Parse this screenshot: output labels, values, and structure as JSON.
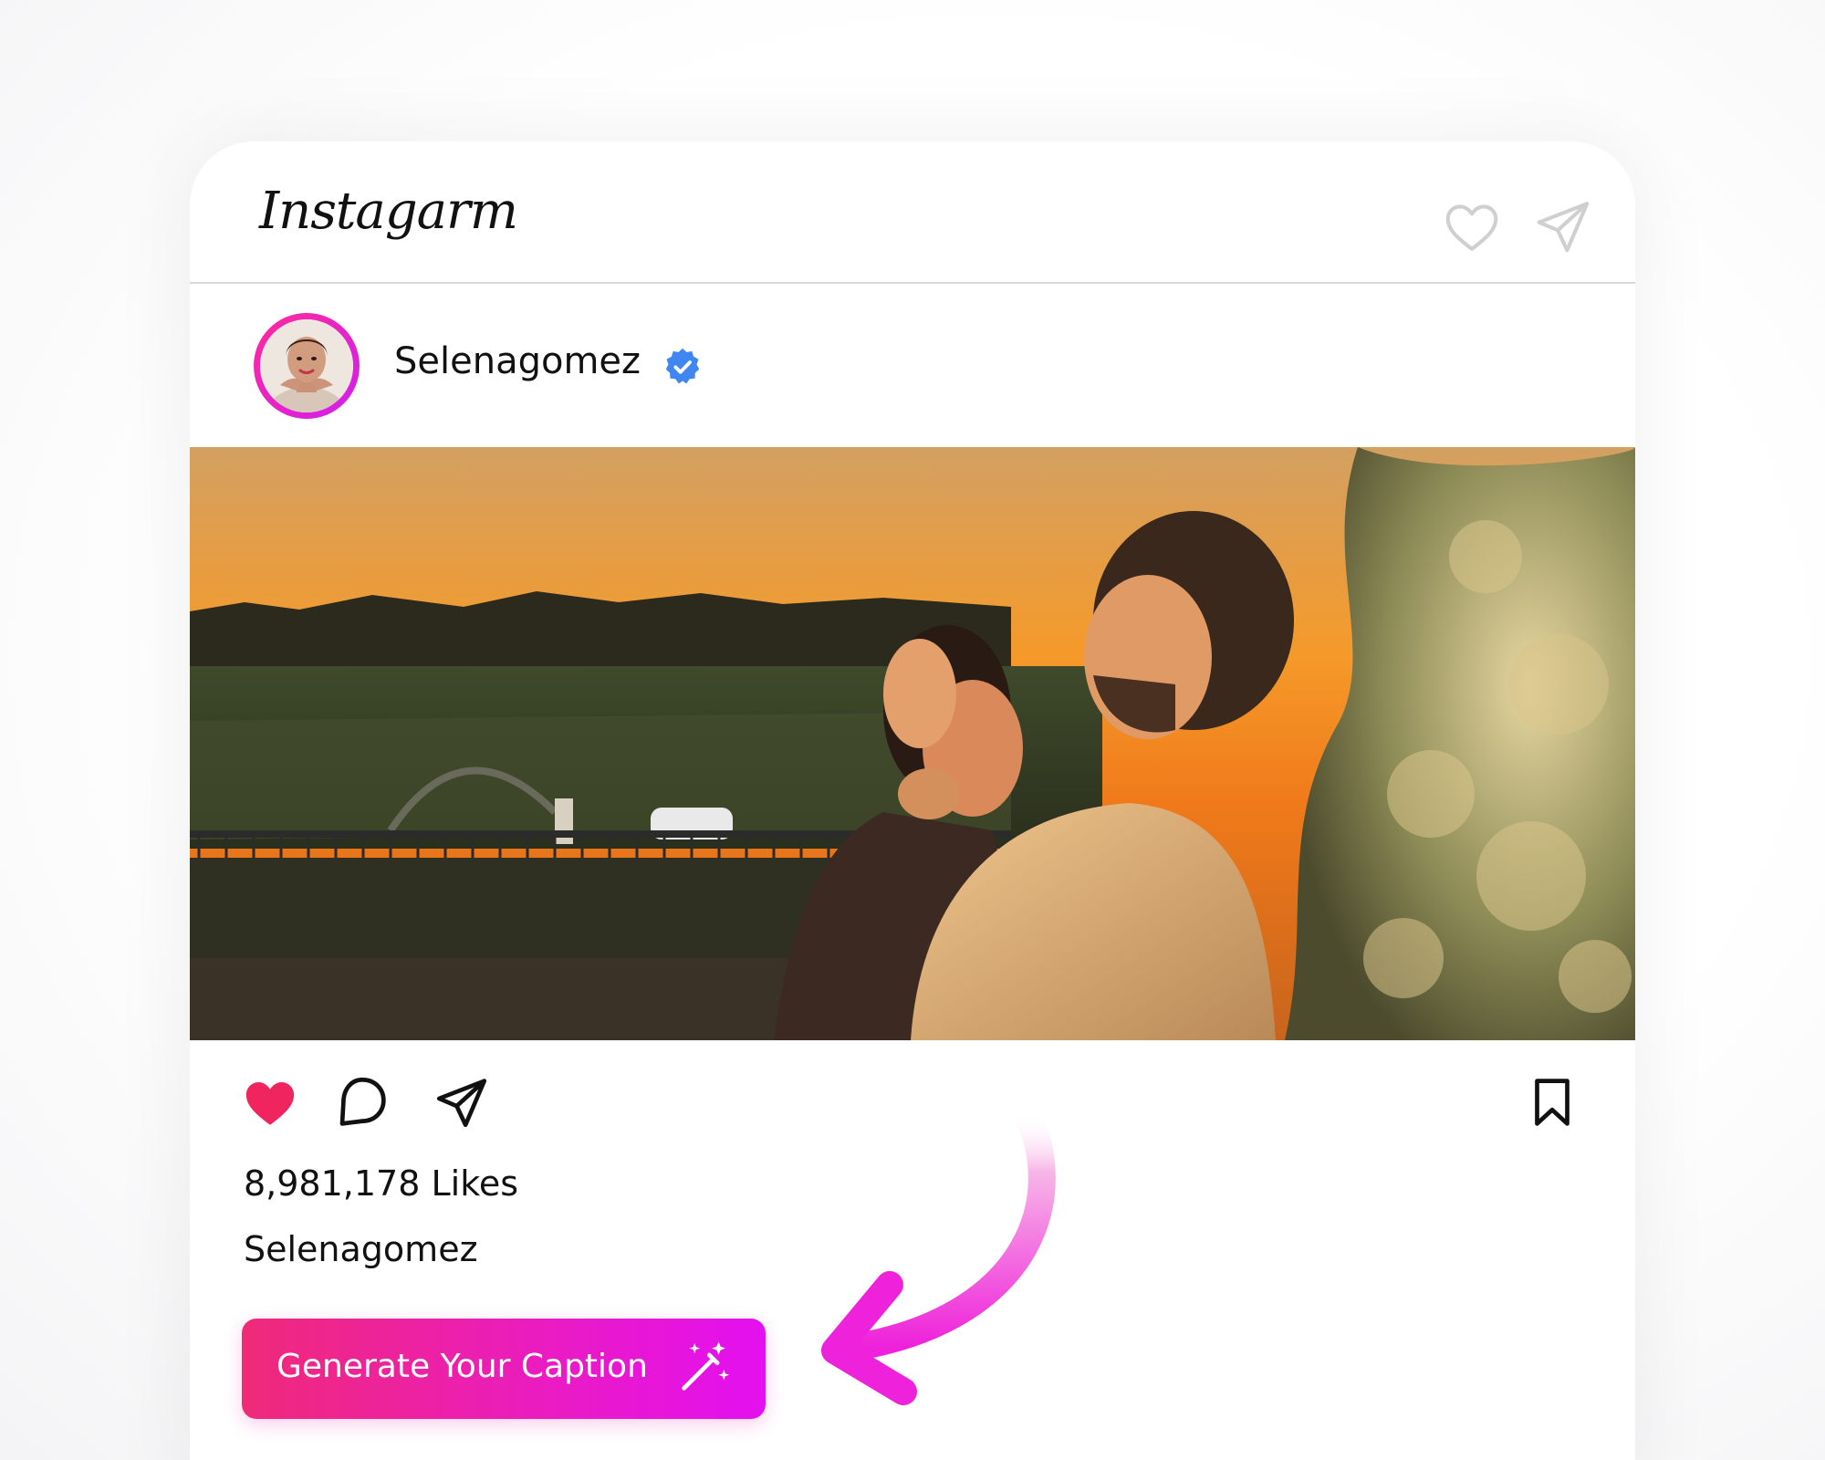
{
  "header": {
    "logo_text": "Instagarm",
    "icons": [
      "heart-outline-icon",
      "send-icon"
    ]
  },
  "post": {
    "username": "Selenagomez",
    "verified": true,
    "photo_description_icon": "post-photo",
    "likes_text": "8,981,178 Likes",
    "caption_username": "Selenagomez"
  },
  "actions": {
    "like_state": "liked",
    "icons": [
      "heart-filled-icon",
      "comment-icon",
      "share-icon",
      "bookmark-icon"
    ]
  },
  "cta": {
    "label": "Generate Your Caption",
    "icon": "magic-wand-icon"
  },
  "colors": {
    "like_red": "#f0245f",
    "verified_blue": "#3f86f0",
    "gradient_start": "#ef2a78",
    "gradient_end": "#e310f0",
    "arrow_pink": "#f04ad6"
  }
}
